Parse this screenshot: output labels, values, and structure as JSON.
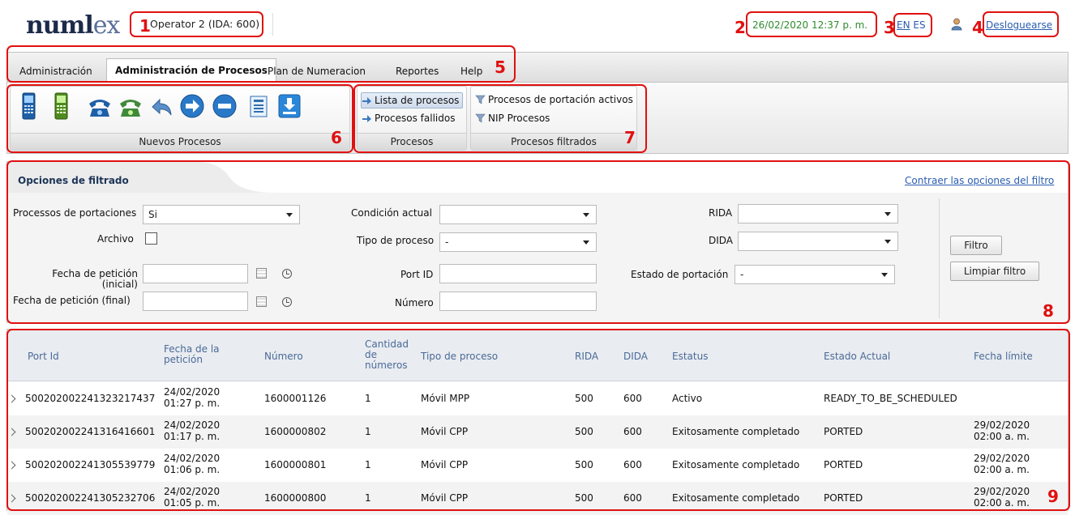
{
  "header": {
    "logo_main": "numl",
    "logo_accent": "ex",
    "operator": "Operator 2 (IDA: 600)",
    "datetime": "26/02/2020 12:37 p. m.",
    "lang_en": "EN",
    "lang_es": "ES",
    "logout": "Desloguearse"
  },
  "menu": {
    "tabs": [
      "Administración",
      "Administración de Procesos",
      "Plan de Numeracion",
      "Reportes",
      "Help"
    ],
    "active": "Administración de Procesos"
  },
  "ribbon": {
    "nuevos_label": "Nuevos Procesos",
    "procesos_label": "Procesos",
    "lista": "Lista de procesos",
    "fallidos": "Procesos fallidos",
    "filtrados_label": "Procesos filtrados",
    "activos": "Procesos de portación activos",
    "nip": "NIP Procesos"
  },
  "filter": {
    "title": "Opciones de filtrado",
    "collapse": "Contraer las opciones del filtro",
    "portaciones_label": "Processos de portaciones",
    "portaciones_value": "Si",
    "archivo_label": "Archivo",
    "fecha_ini_label": "Fecha de petición (inicial)",
    "fecha_fin_label": "Fecha de petición (final)",
    "condicion_label": "Condición actual",
    "tipo_label": "Tipo de proceso",
    "tipo_value": "-",
    "portid_label": "Port ID",
    "numero_label": "Número",
    "rida_label": "RIDA",
    "dida_label": "DIDA",
    "estado_label": "Estado de portación",
    "estado_value": "-",
    "btn_filtro": "Filtro",
    "btn_limpiar": "Limpiar filtro"
  },
  "table": {
    "headers": {
      "port_id": "Port Id",
      "fecha_1": "Fecha de la",
      "fecha_2": "petición",
      "numero": "Número",
      "cant_1": "Cantidad",
      "cant_2": "de",
      "cant_3": "números",
      "tipo": "Tipo de proceso",
      "rida": "RIDA",
      "dida": "DIDA",
      "estatus": "Estatus",
      "estado": "Estado Actual",
      "limite": "Fecha límite"
    },
    "rows": [
      {
        "port_id": "500202002241323217437",
        "fecha_d": "24/02/2020",
        "fecha_t": "01:27 p. m.",
        "numero": "1600001126",
        "cant": "1",
        "tipo": "Móvil MPP",
        "rida": "500",
        "dida": "600",
        "estatus": "Activo",
        "estado": "READY_TO_BE_SCHEDULED",
        "lim_d": "",
        "lim_t": ""
      },
      {
        "port_id": "500202002241316416601",
        "fecha_d": "24/02/2020",
        "fecha_t": "01:17 p. m.",
        "numero": "1600000802",
        "cant": "1",
        "tipo": "Móvil CPP",
        "rida": "500",
        "dida": "600",
        "estatus": "Exitosamente completado",
        "estado": "PORTED",
        "lim_d": "29/02/2020",
        "lim_t": "02:00 a. m."
      },
      {
        "port_id": "500202002241305539779",
        "fecha_d": "24/02/2020",
        "fecha_t": "01:06 p. m.",
        "numero": "1600000801",
        "cant": "1",
        "tipo": "Móvil CPP",
        "rida": "500",
        "dida": "600",
        "estatus": "Exitosamente completado",
        "estado": "PORTED",
        "lim_d": "29/02/2020",
        "lim_t": "02:00 a. m."
      },
      {
        "port_id": "500202002241305232706",
        "fecha_d": "24/02/2020",
        "fecha_t": "01:05 p. m.",
        "numero": "1600000800",
        "cant": "1",
        "tipo": "Móvil CPP",
        "rida": "500",
        "dida": "600",
        "estatus": "Exitosamente completado",
        "estado": "PORTED",
        "lim_d": "29/02/2020",
        "lim_t": "02:00 a. m."
      }
    ]
  },
  "annotations": [
    "1",
    "2",
    "3",
    "4",
    "5",
    "6",
    "7",
    "8",
    "9"
  ],
  "colors": {
    "annotation": "#e01010",
    "link": "#2a5db0",
    "datetime": "#2e8b2e",
    "header_text": "#4a6a99"
  }
}
